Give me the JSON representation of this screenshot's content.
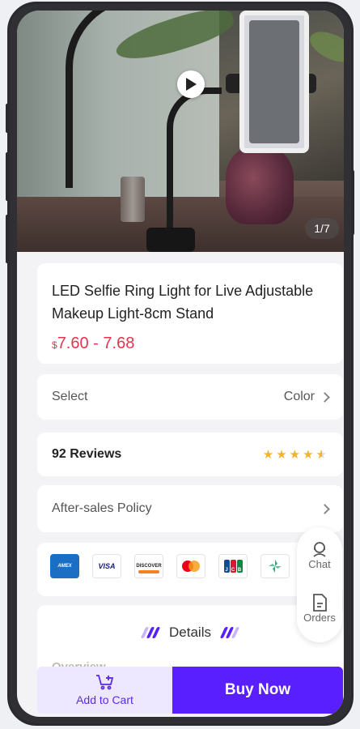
{
  "media": {
    "counter": "1/7",
    "play_icon": "play-icon"
  },
  "product": {
    "title": "LED Selfie Ring Light for Live Adjustable Makeup Light-8cm Stand",
    "currency": "$",
    "price": "7.60 - 7.68"
  },
  "select_row": {
    "label": "Select",
    "value": "Color"
  },
  "reviews": {
    "label": "92 Reviews",
    "rating": 4.5,
    "star_color": "#f4b32a"
  },
  "after_sales": {
    "label": "After-sales Policy"
  },
  "payments": {
    "amex": "AMEX",
    "visa": "VISA",
    "discover": "DISCOVER",
    "mastercard": "mastercard-icon",
    "jcb": "JCB",
    "other": "other-payment-icon"
  },
  "details": {
    "title": "Details",
    "overview": "Overview"
  },
  "floating": {
    "chat": "Chat",
    "orders": "Orders"
  },
  "bottom": {
    "add_to_cart": "Add to Cart",
    "buy_now": "Buy Now",
    "accent": "#5a1fff"
  }
}
